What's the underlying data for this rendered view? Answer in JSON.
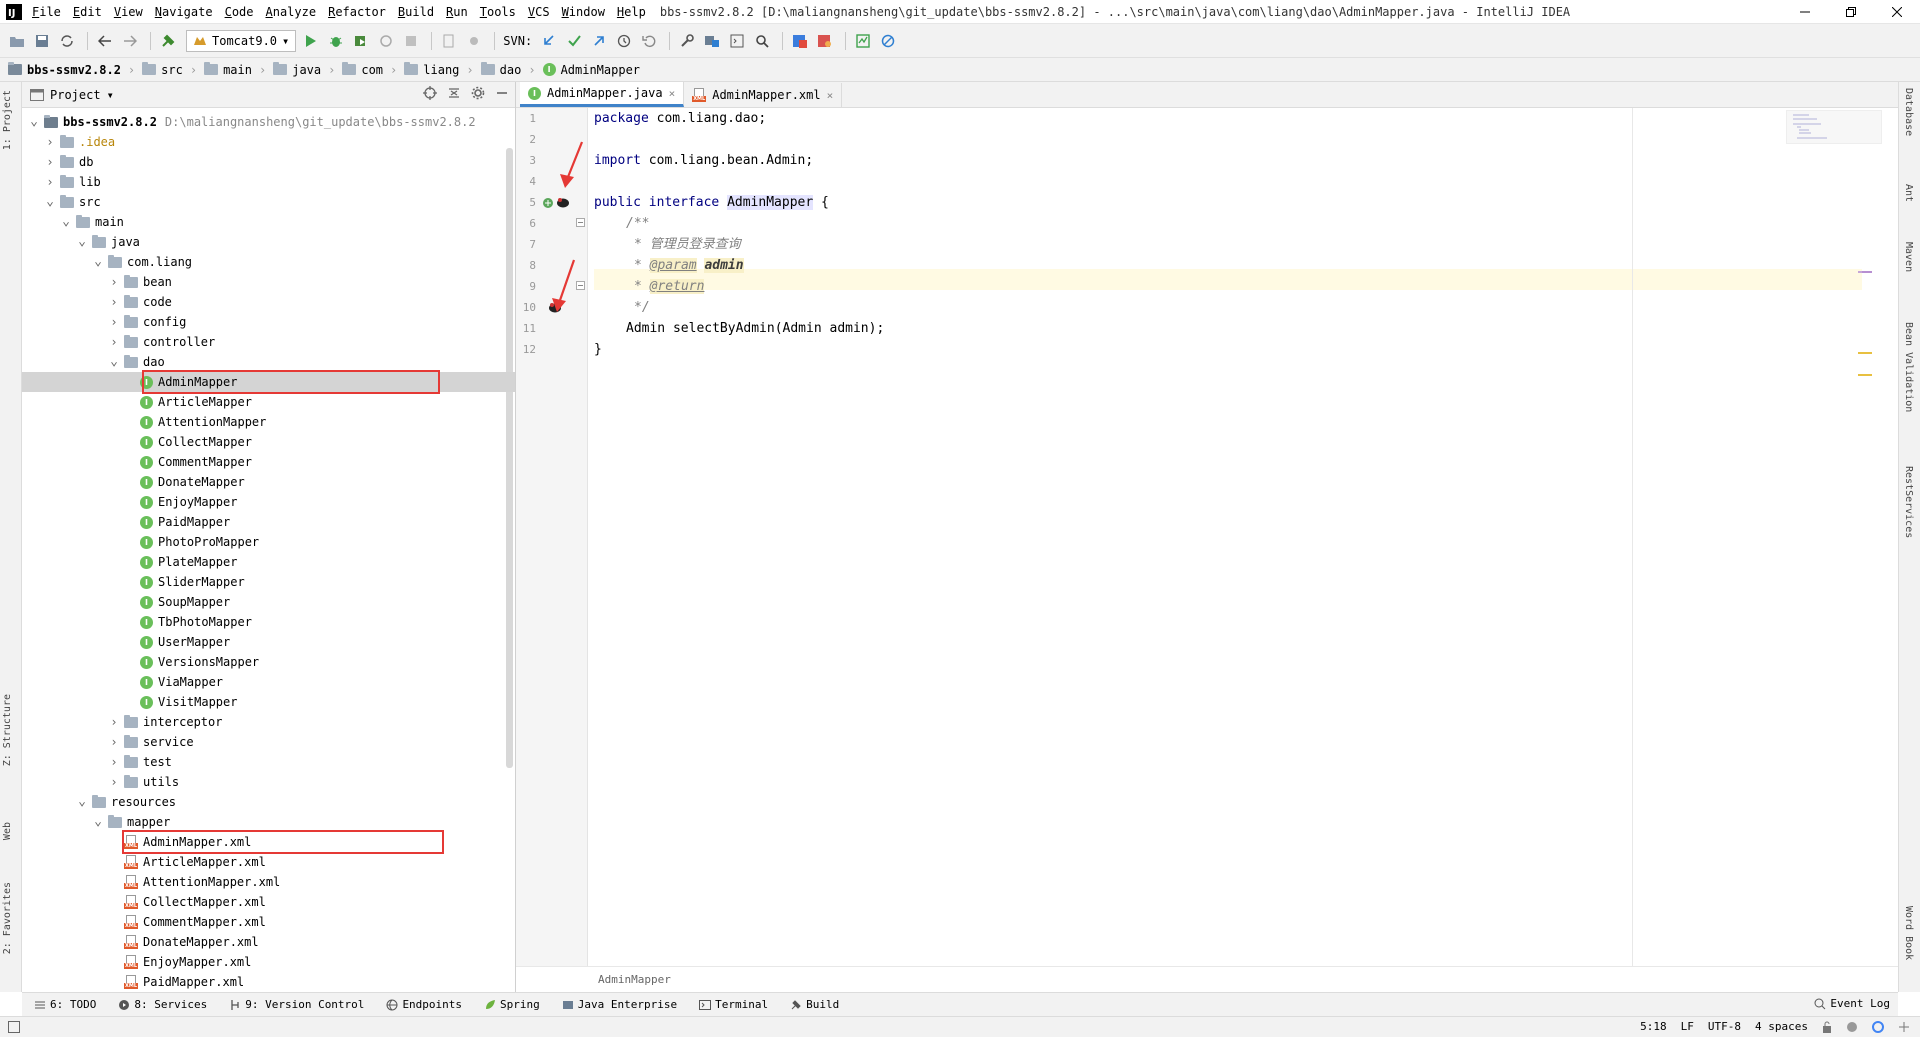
{
  "window": {
    "title": "bbs-ssmv2.8.2 [D:\\maliangnansheng\\git_update\\bbs-ssmv2.8.2] - ...\\src\\main\\java\\com\\liang\\dao\\AdminMapper.java - IntelliJ IDEA",
    "logo_text": "IJ"
  },
  "menu": [
    "File",
    "Edit",
    "View",
    "Navigate",
    "Code",
    "Analyze",
    "Refactor",
    "Build",
    "Run",
    "Tools",
    "VCS",
    "Window",
    "Help"
  ],
  "toolbar": {
    "run_config": "Tomcat9.0",
    "svn_label": "SVN:"
  },
  "breadcrumb": [
    "bbs-ssmv2.8.2",
    "src",
    "main",
    "java",
    "com",
    "liang",
    "dao",
    "AdminMapper"
  ],
  "left_strip": [
    "1: Project",
    "Z: Structure",
    "Web",
    "2: Favorites"
  ],
  "right_strip": [
    "Database",
    "Ant",
    "Maven",
    "Bean Validation",
    "RestServices",
    "Word Book"
  ],
  "project": {
    "header": "Project",
    "root_name": "bbs-ssmv2.8.2",
    "root_path": "D:\\maliangnansheng\\git_update\\bbs-ssmv2.8.2",
    "nodes": [
      {
        "label": ".idea",
        "type": "folder",
        "color": "#b8860b"
      },
      {
        "label": "db",
        "type": "folder"
      },
      {
        "label": "lib",
        "type": "folder"
      },
      {
        "label": "src",
        "type": "folder"
      },
      {
        "label": "main",
        "type": "folder"
      },
      {
        "label": "java",
        "type": "folder"
      },
      {
        "label": "com.liang",
        "type": "folder"
      },
      {
        "label": "bean",
        "type": "folder"
      },
      {
        "label": "code",
        "type": "folder"
      },
      {
        "label": "config",
        "type": "folder"
      },
      {
        "label": "controller",
        "type": "folder"
      },
      {
        "label": "dao",
        "type": "folder"
      },
      {
        "label": "AdminMapper",
        "type": "interface"
      },
      {
        "label": "ArticleMapper",
        "type": "interface"
      },
      {
        "label": "AttentionMapper",
        "type": "interface"
      },
      {
        "label": "CollectMapper",
        "type": "interface"
      },
      {
        "label": "CommentMapper",
        "type": "interface"
      },
      {
        "label": "DonateMapper",
        "type": "interface"
      },
      {
        "label": "EnjoyMapper",
        "type": "interface"
      },
      {
        "label": "PaidMapper",
        "type": "interface"
      },
      {
        "label": "PhotoProMapper",
        "type": "interface"
      },
      {
        "label": "PlateMapper",
        "type": "interface"
      },
      {
        "label": "SliderMapper",
        "type": "interface"
      },
      {
        "label": "SoupMapper",
        "type": "interface"
      },
      {
        "label": "TbPhotoMapper",
        "type": "interface"
      },
      {
        "label": "UserMapper",
        "type": "interface"
      },
      {
        "label": "VersionsMapper",
        "type": "interface"
      },
      {
        "label": "ViaMapper",
        "type": "interface"
      },
      {
        "label": "VisitMapper",
        "type": "interface"
      },
      {
        "label": "interceptor",
        "type": "folder"
      },
      {
        "label": "service",
        "type": "folder"
      },
      {
        "label": "test",
        "type": "folder"
      },
      {
        "label": "utils",
        "type": "folder"
      },
      {
        "label": "resources",
        "type": "folder"
      },
      {
        "label": "mapper",
        "type": "folder"
      },
      {
        "label": "AdminMapper.xml",
        "type": "xml"
      },
      {
        "label": "ArticleMapper.xml",
        "type": "xml"
      },
      {
        "label": "AttentionMapper.xml",
        "type": "xml"
      },
      {
        "label": "CollectMapper.xml",
        "type": "xml"
      },
      {
        "label": "CommentMapper.xml",
        "type": "xml"
      },
      {
        "label": "DonateMapper.xml",
        "type": "xml"
      },
      {
        "label": "EnjoyMapper.xml",
        "type": "xml"
      },
      {
        "label": "PaidMapper.xml",
        "type": "xml"
      }
    ]
  },
  "editor": {
    "tabs": [
      {
        "label": "AdminMapper.java",
        "active": true,
        "icon": "interface-icon"
      },
      {
        "label": "AdminMapper.xml",
        "active": false,
        "icon": "xml-file-icon"
      }
    ],
    "line_numbers": [
      "1",
      "2",
      "3",
      "4",
      "5",
      "6",
      "7",
      "8",
      "9",
      "10",
      "11",
      "12"
    ],
    "code": {
      "l1_kw": "package",
      "l1_rest": " com.liang.dao;",
      "l3_kw": "import",
      "l3_rest": " com.liang.bean.Admin;",
      "l5_kw1": "public",
      "l5_kw2": "interface",
      "l5_name": "AdminMapper",
      "l5_rest": " {",
      "l6": "/**",
      "l7": "* 管理员登录查询",
      "l8_star": "* ",
      "l8_tag": "@param",
      "l8_name": "admin",
      "l9_star": "* ",
      "l9_tag": "@return",
      "l10": "*/",
      "l11": "Admin selectByAdmin(Admin admin);",
      "l12": "}"
    },
    "footer_breadcrumb": "AdminMapper"
  },
  "toolwindows": [
    {
      "label": "6: TODO",
      "icon": "todo-icon"
    },
    {
      "label": "8: Services",
      "icon": "services-icon"
    },
    {
      "label": "9: Version Control",
      "icon": "vcs-icon"
    },
    {
      "label": "Endpoints",
      "icon": "endpoints-icon"
    },
    {
      "label": "Spring",
      "icon": "spring-icon"
    },
    {
      "label": "Java Enterprise",
      "icon": "java-enterprise-icon"
    },
    {
      "label": "Terminal",
      "icon": "terminal-icon"
    },
    {
      "label": "Build",
      "icon": "build-icon"
    }
  ],
  "event_log": "Event Log",
  "status": {
    "position": "5:18",
    "line_sep": "LF",
    "encoding": "UTF-8",
    "indent": "4 spaces"
  },
  "colors": {
    "accent": "#4083c9",
    "interface_icon": "#6abf5a",
    "xml_icon": "#e05a2b",
    "highlight_box": "#e53935",
    "keyword": "#000080"
  }
}
